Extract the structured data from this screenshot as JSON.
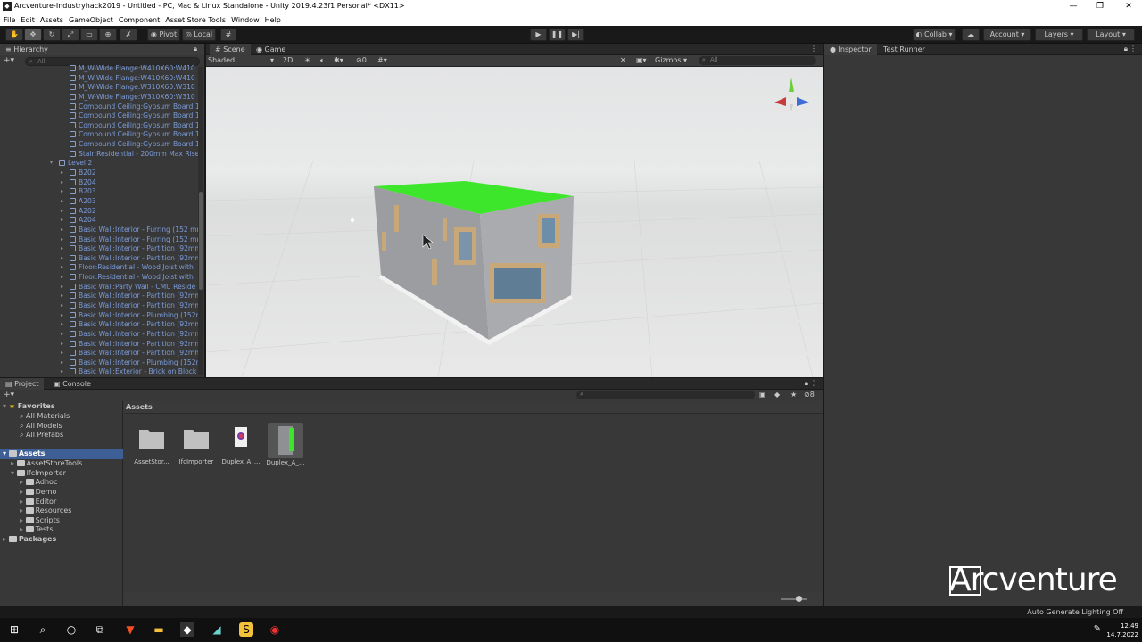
{
  "window": {
    "title": "Arcventure-Industryhack2019 - Untitled - PC, Mac & Linux Standalone - Unity 2019.4.23f1 Personal* <DX11>",
    "app_icon": "unity-icon"
  },
  "menu": [
    "File",
    "Edit",
    "Assets",
    "GameObject",
    "Component",
    "Asset Store Tools",
    "Window",
    "Help"
  ],
  "toolbar": {
    "pivot": "Pivot",
    "local": "Local",
    "collab": "Collab",
    "account": "Account",
    "layers": "Layers",
    "layout": "Layout"
  },
  "hierarchy": {
    "tab": "Hierarchy",
    "search_placeholder": "All",
    "items": [
      {
        "label": "M_W-Wide Flange:W410X60:W410",
        "indent": 2
      },
      {
        "label": "M_W-Wide Flange:W410X60:W410",
        "indent": 2
      },
      {
        "label": "M_W-Wide Flange:W310X60:W310",
        "indent": 2
      },
      {
        "label": "M_W-Wide Flange:W310X60:W310",
        "indent": 2
      },
      {
        "label": "Compound Ceiling:Gypsum Board:1",
        "indent": 2
      },
      {
        "label": "Compound Ceiling:Gypsum Board:1",
        "indent": 2
      },
      {
        "label": "Compound Ceiling:Gypsum Board:1",
        "indent": 2
      },
      {
        "label": "Compound Ceiling:Gypsum Board:1",
        "indent": 2
      },
      {
        "label": "Compound Ceiling:Gypsum Board:1",
        "indent": 2
      },
      {
        "label": "Stair:Residential - 200mm Max Rise",
        "indent": 2
      },
      {
        "label": "Level 2",
        "indent": 1,
        "expanded": true
      },
      {
        "label": "B202",
        "indent": 2,
        "arrow": true
      },
      {
        "label": "B204",
        "indent": 2,
        "arrow": true
      },
      {
        "label": "B203",
        "indent": 2,
        "arrow": true
      },
      {
        "label": "A203",
        "indent": 2,
        "arrow": true
      },
      {
        "label": "A202",
        "indent": 2,
        "arrow": true
      },
      {
        "label": "A204",
        "indent": 2,
        "arrow": true
      },
      {
        "label": "Basic Wall:Interior - Furring (152 mm",
        "indent": 2,
        "arrow": true
      },
      {
        "label": "Basic Wall:Interior - Furring (152 mm",
        "indent": 2,
        "arrow": true
      },
      {
        "label": "Basic Wall:Interior - Partition (92mm",
        "indent": 2,
        "arrow": true
      },
      {
        "label": "Basic Wall:Interior - Partition (92mm",
        "indent": 2,
        "arrow": true
      },
      {
        "label": "Floor:Residential - Wood Joist with",
        "indent": 2,
        "arrow": true
      },
      {
        "label": "Floor:Residential - Wood Joist with",
        "indent": 2,
        "arrow": true
      },
      {
        "label": "Basic Wall:Party Wall - CMU Reside",
        "indent": 2,
        "arrow": true
      },
      {
        "label": "Basic Wall:Interior - Partition (92mm",
        "indent": 2,
        "arrow": true
      },
      {
        "label": "Basic Wall:Interior - Partition (92mm",
        "indent": 2,
        "arrow": true
      },
      {
        "label": "Basic Wall:Interior - Plumbing (152n",
        "indent": 2,
        "arrow": true
      },
      {
        "label": "Basic Wall:Interior - Partition (92mm",
        "indent": 2,
        "arrow": true
      },
      {
        "label": "Basic Wall:Interior - Partition (92mm",
        "indent": 2,
        "arrow": true
      },
      {
        "label": "Basic Wall:Interior - Partition (92mm",
        "indent": 2,
        "arrow": true
      },
      {
        "label": "Basic Wall:Interior - Partition (92mm",
        "indent": 2,
        "arrow": true
      },
      {
        "label": "Basic Wall:Interior - Plumbing (152n",
        "indent": 2,
        "arrow": true
      },
      {
        "label": "Basic Wall:Exterior - Brick on Block",
        "indent": 2,
        "arrow": true
      }
    ]
  },
  "scene": {
    "tab_scene": "Scene",
    "tab_game": "Game",
    "shading": "Shaded",
    "mode_2d": "2D",
    "fx_count": "0",
    "gizmos": "Gizmos",
    "search_placeholder": "All",
    "roof_color": "#3de62a",
    "wall_color": "#a9abae"
  },
  "project": {
    "tab_project": "Project",
    "tab_console": "Console",
    "favorites_title": "Favorites",
    "favorites": [
      "All Materials",
      "All Models",
      "All Prefabs"
    ],
    "assets_title": "Assets",
    "tree": [
      {
        "label": "AssetStoreTools",
        "indent": 1
      },
      {
        "label": "IfcImporter",
        "indent": 1
      },
      {
        "label": "Adhoc",
        "indent": 2
      },
      {
        "label": "Demo",
        "indent": 2
      },
      {
        "label": "Editor",
        "indent": 2
      },
      {
        "label": "Resources",
        "indent": 2
      },
      {
        "label": "Scripts",
        "indent": 2
      },
      {
        "label": "Tests",
        "indent": 2
      }
    ],
    "packages": "Packages",
    "breadcrumb": "Assets",
    "hidden_count": "8",
    "assets": [
      {
        "label": "AssetStor...",
        "kind": "folder"
      },
      {
        "label": "IfcImporter",
        "kind": "folder"
      },
      {
        "label": "Duplex_A_...",
        "kind": "ifc-file"
      },
      {
        "label": "Duplex_A_...",
        "kind": "model"
      }
    ]
  },
  "inspector": {
    "tab_inspector": "Inspector",
    "tab_test_runner": "Test Runner"
  },
  "watermark": "Arcventure",
  "status": {
    "lighting": "Auto Generate Lighting Off"
  },
  "taskbar": {
    "time": "12.49",
    "date": "14.7.2022"
  }
}
